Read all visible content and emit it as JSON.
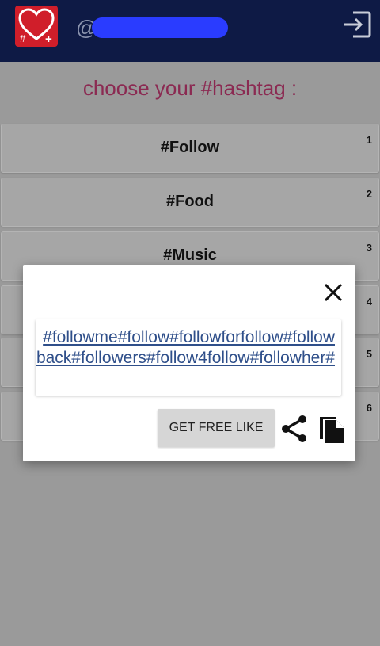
{
  "header": {
    "username_prefix": "@",
    "icons": {
      "logo": "heart-hashtag-logo",
      "exit": "exit-icon"
    },
    "logo_hash": "#",
    "logo_plus": "+"
  },
  "main": {
    "title": "choose your #hashtag :",
    "items": [
      {
        "label": "#Follow",
        "number": "1"
      },
      {
        "label": "#Food",
        "number": "2"
      },
      {
        "label": "#Music",
        "number": "3"
      },
      {
        "label": "",
        "number": "4"
      },
      {
        "label": "",
        "number": "5"
      },
      {
        "label": "",
        "number": "6"
      }
    ]
  },
  "dialog": {
    "hashtags": "#followme#follow#followforfollow#followback#followers#follow4follow#followher#",
    "get_free_like_label": "GET FREE LIKE",
    "icons": {
      "close": "close-icon",
      "share": "share-icon",
      "copy": "copy-icon"
    }
  },
  "colors": {
    "topbar": "#0e1a45",
    "logo": "#d01e2a",
    "title": "#8b2a52",
    "link": "#2f4f8a",
    "redaction": "#2a3cff"
  }
}
